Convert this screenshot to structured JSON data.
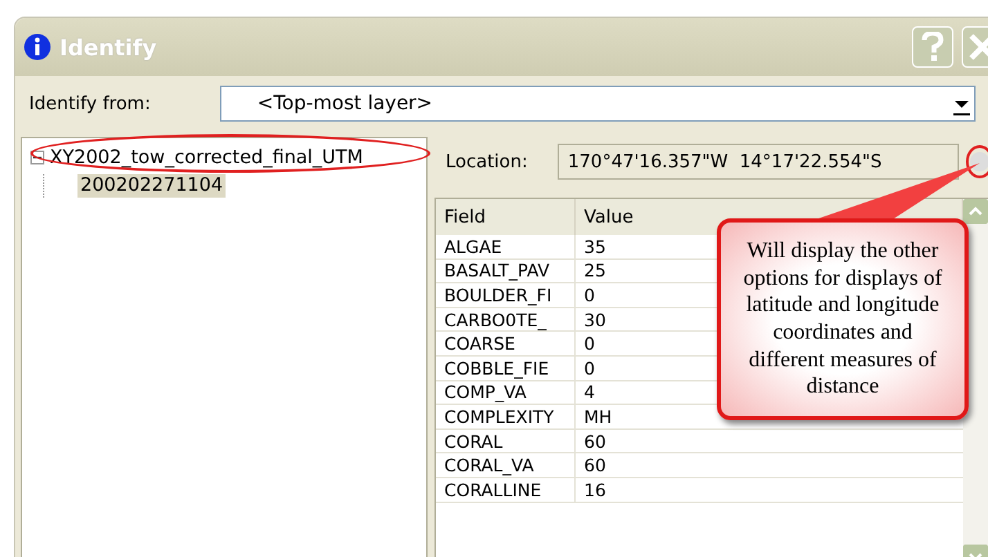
{
  "window": {
    "title": "Identify"
  },
  "identify_from": {
    "label": "Identify from:",
    "value": "<Top-most layer>"
  },
  "tree": [
    {
      "label": "XY2002_tow_corrected_final_UTM",
      "expanded": true,
      "selected": false,
      "children": [
        {
          "label": "200202271104",
          "selected": true
        }
      ]
    }
  ],
  "location": {
    "label": "Location:",
    "value": "170°47'16.357\"W  14°17'22.554\"S"
  },
  "table": {
    "columns": [
      "Field",
      "Value"
    ],
    "rows": [
      [
        "ALGAE",
        "35"
      ],
      [
        "BASALT_PAV",
        "25"
      ],
      [
        "BOULDER_FI",
        "0"
      ],
      [
        "CARBO0TE_",
        "30"
      ],
      [
        "COARSE",
        "0"
      ],
      [
        "COBBLE_FIE",
        "0"
      ],
      [
        "COMP_VA",
        "4"
      ],
      [
        "COMPLEXITY",
        "MH"
      ],
      [
        "CORAL",
        "60"
      ],
      [
        "CORAL_VA",
        "60"
      ],
      [
        "CORALLINE",
        "16"
      ]
    ]
  },
  "callout": {
    "text": "Will display the other options for displays of latitude and longitude coordinates and different measures of distance"
  }
}
